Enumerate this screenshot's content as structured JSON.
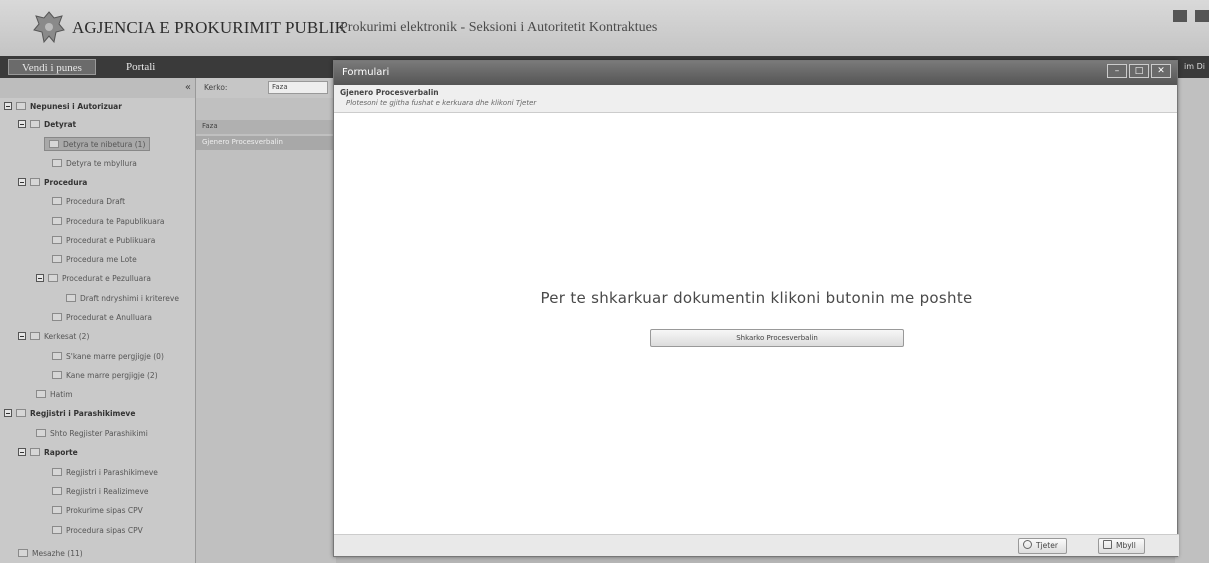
{
  "header": {
    "agency": "AGJENCIA E PROKURIMIT PUBLIK",
    "subtitle": "Prokurimi elektronik - Seksioni i Autoritetit Kontraktues"
  },
  "tabs": {
    "workspace": "Vendi i punes",
    "portal": "Portali"
  },
  "tabbar_right": "im Di",
  "sidebar": {
    "items": [
      {
        "label": "Nepunesi i Autorizuar"
      },
      {
        "label": "Detyrat"
      },
      {
        "label": "Detyra te nibetura (1)"
      },
      {
        "label": "Detyra te mbyllura"
      },
      {
        "label": "Procedura"
      },
      {
        "label": "Procedura Draft"
      },
      {
        "label": "Procedura te Papublikuara"
      },
      {
        "label": "Procedurat e Publikuara"
      },
      {
        "label": "Procedura me Lote"
      },
      {
        "label": "Procedurat e Pezulluara"
      },
      {
        "label": "Draft ndryshimi i kritereve"
      },
      {
        "label": "Procedurat e Anulluara"
      },
      {
        "label": "Kerkesat (2)"
      },
      {
        "label": "S'kane marre pergjigje (0)"
      },
      {
        "label": "Kane marre pergjigje (2)"
      },
      {
        "label": "Hatim"
      },
      {
        "label": "Regjistri i Parashikimeve"
      },
      {
        "label": "Shto Regjister Parashikimi"
      },
      {
        "label": "Raporte"
      },
      {
        "label": "Regjistri i Parashikimeve"
      },
      {
        "label": "Regjistri i Realizimeve"
      },
      {
        "label": "Prokurime sipas CPV"
      },
      {
        "label": "Procedura sipas CPV"
      },
      {
        "label": "Mesazhe (11)"
      }
    ]
  },
  "grid": {
    "search_label": "Kerko:",
    "search_value": "Faza",
    "column": "Faza",
    "row": "Gjenero Procesverbalin"
  },
  "modal": {
    "title": "Formulari",
    "heading": "Gjenero Procesverbalin",
    "instruction": "Plotesoni te gjitha fushat e kerkuara dhe klikoni Tjeter",
    "message": "Per te shkarkuar dokumentin klikoni butonin me poshte",
    "download_button": "Shkarko Procesverbalin",
    "next_button": "Tjeter",
    "close_button": "Mbyll"
  },
  "colors": {
    "title_bar": "#555555",
    "background": "#b5b5b5"
  }
}
